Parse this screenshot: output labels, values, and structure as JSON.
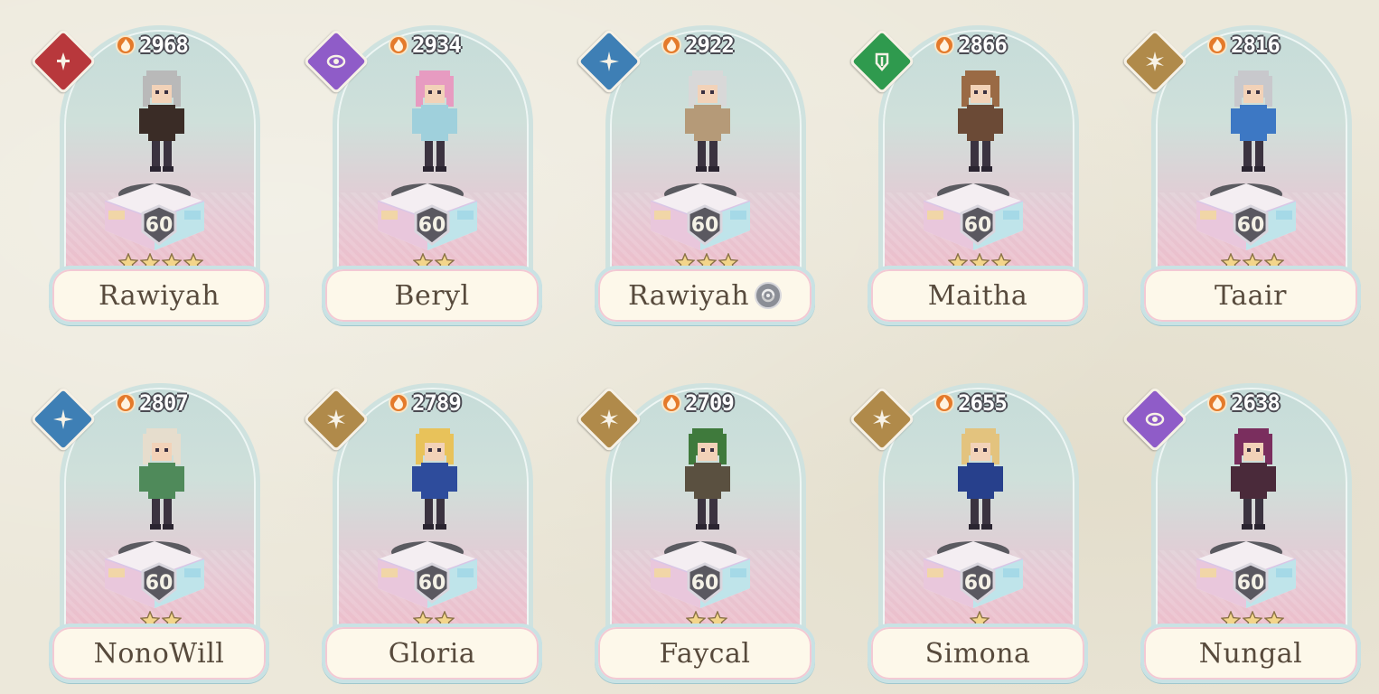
{
  "roster": [
    {
      "name": "Rawiyah",
      "power": "2968",
      "level": "60",
      "stars": 4,
      "element": "fire-element-icon",
      "elem_class": "fire",
      "hair": "#b9b9b9",
      "outfit": "#3a2c26",
      "alt": false
    },
    {
      "name": "Beryl",
      "power": "2934",
      "level": "60",
      "stars": 2,
      "element": "arcane-element-icon",
      "elem_class": "arcane",
      "hair": "#e79bc1",
      "outfit": "#9fd0dc",
      "alt": false
    },
    {
      "name": "Rawiyah",
      "power": "2922",
      "level": "60",
      "stars": 3,
      "element": "wind-element-icon",
      "elem_class": "wind",
      "hair": "#d8d8d8",
      "outfit": "#b59a78",
      "alt": true
    },
    {
      "name": "Maitha",
      "power": "2866",
      "level": "60",
      "stars": 3,
      "element": "earth-element-icon",
      "elem_class": "earth",
      "hair": "#9a6a45",
      "outfit": "#6b4a36",
      "alt": false
    },
    {
      "name": "Taair",
      "power": "2816",
      "level": "60",
      "stars": 3,
      "element": "light-element-icon",
      "elem_class": "light",
      "hair": "#c8c8cc",
      "outfit": "#3d78c4",
      "alt": false
    },
    {
      "name": "NonoWill",
      "power": "2807",
      "level": "60",
      "stars": 2,
      "element": "wind-element-icon",
      "elem_class": "wind",
      "hair": "#e6ddcd",
      "outfit": "#4f8a5a",
      "alt": false
    },
    {
      "name": "Gloria",
      "power": "2789",
      "level": "60",
      "stars": 2,
      "element": "light-element-icon",
      "elem_class": "light",
      "hair": "#e8c25a",
      "outfit": "#2e4c9c",
      "alt": false
    },
    {
      "name": "Faycal",
      "power": "2709",
      "level": "60",
      "stars": 2,
      "element": "light-element-icon",
      "elem_class": "light",
      "hair": "#3f7a3c",
      "outfit": "#5a5040",
      "alt": false
    },
    {
      "name": "Simona",
      "power": "2655",
      "level": "60",
      "stars": 1,
      "element": "light-element-icon",
      "elem_class": "light",
      "hair": "#e3c37e",
      "outfit": "#27408c",
      "alt": false
    },
    {
      "name": "Nungal",
      "power": "2638",
      "level": "60",
      "stars": 3,
      "element": "arcane-element-icon",
      "elem_class": "arcane",
      "hair": "#7a2e5e",
      "outfit": "#4a2a3a",
      "alt": false
    }
  ]
}
